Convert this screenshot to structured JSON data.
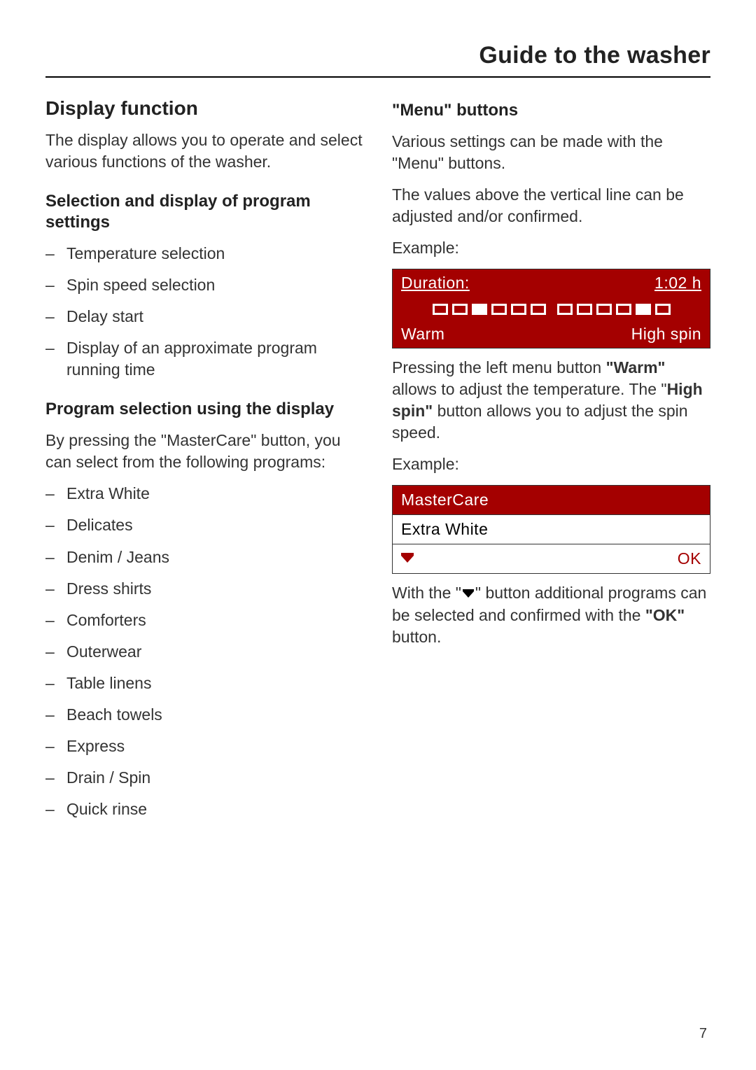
{
  "header": {
    "title": "Guide to the washer"
  },
  "left": {
    "h2": "Display function",
    "p1": "The display allows you to operate and select various functions of the washer.",
    "sub1": "Selection and display of program settings",
    "list1": [
      "Temperature selection",
      "Spin speed selection",
      "Delay start",
      "Display of an approximate program running time"
    ],
    "sub2": "Program selection using the display",
    "p2": "By pressing the \"MasterCare\" button, you can select from the following programs:",
    "list2": [
      "Extra White",
      "Delicates",
      "Denim / Jeans",
      "Dress shirts",
      "Comforters",
      "Outerwear",
      "Table linens",
      "Beach towels",
      "Express",
      "Drain / Spin",
      "Quick rinse"
    ]
  },
  "right": {
    "sub1": "\"Menu\" buttons",
    "p1": "Various settings can be made with the \"Menu\" buttons.",
    "p2": "The values above the vertical line can be adjusted and/or confirmed.",
    "ex_label": "Example:",
    "disp1": {
      "duration_label": "Duration:",
      "duration_value": "1:02 h",
      "warm": "Warm",
      "highspin": "High spin"
    },
    "para_warm_1": "Pressing the left menu button ",
    "para_warm_b1": "\"Warm\"",
    "para_warm_2": " allows to adjust the temperature.  The \"",
    "para_warm_b2": "High spin\"",
    "para_warm_3": " button allows you to adjust the spin speed.",
    "disp2": {
      "title": "MasterCare",
      "item": "Extra White",
      "ok": "OK"
    },
    "para_ok_1": "With the \"",
    "para_ok_2": "\" button additional programs can be selected and confirmed with the ",
    "para_ok_b": "\"OK\"",
    "para_ok_3": " button."
  },
  "page_number": "7"
}
